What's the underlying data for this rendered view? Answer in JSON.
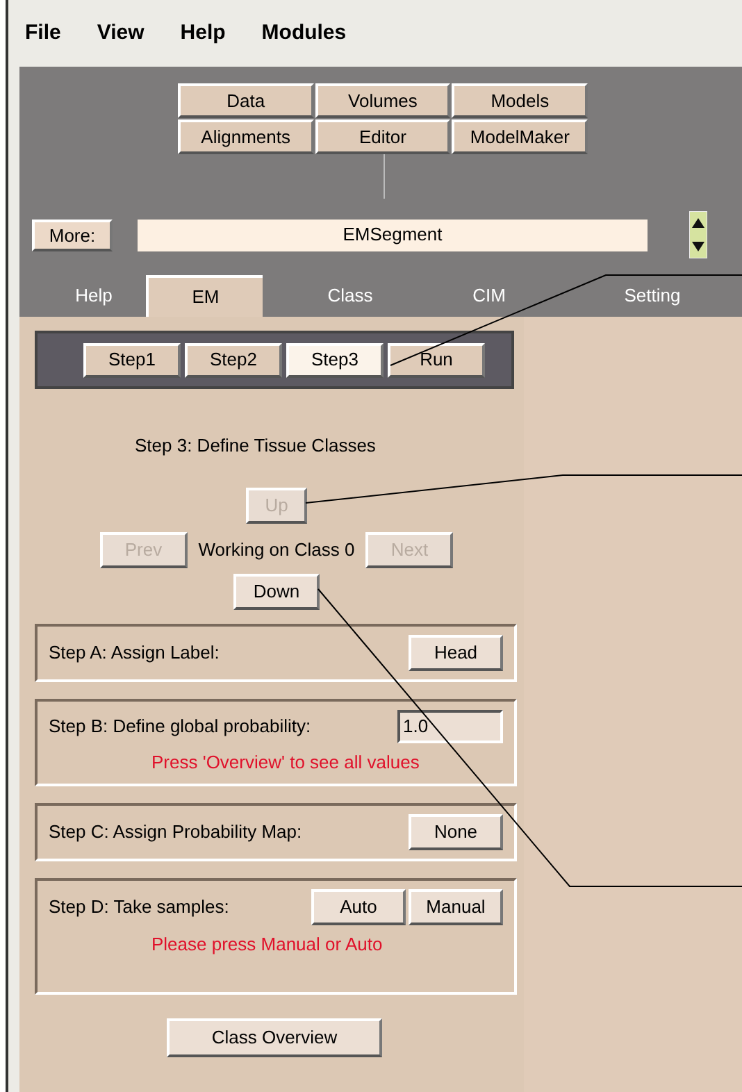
{
  "menu": [
    "File",
    "View",
    "Help",
    "Modules"
  ],
  "module_buttons": [
    "Data",
    "Volumes",
    "Models",
    "Alignments",
    "Editor",
    "ModelMaker"
  ],
  "more_button": "More:",
  "module_field": {
    "value": "EMSegment"
  },
  "tabs": [
    {
      "label": "Help",
      "selected": false
    },
    {
      "label": "EM",
      "selected": true
    },
    {
      "label": "Class",
      "selected": false
    },
    {
      "label": "CIM",
      "selected": false
    },
    {
      "label": "Setting",
      "selected": false
    }
  ],
  "step_buttons": [
    {
      "label": "Step1",
      "selected": false
    },
    {
      "label": "Step2",
      "selected": false
    },
    {
      "label": "Step3",
      "selected": true
    },
    {
      "label": "Run",
      "selected": false
    }
  ],
  "heading": "Step 3: Define Tissue Classes",
  "navigation": {
    "up": {
      "label": "Up",
      "disabled": true
    },
    "prev": {
      "label": "Prev",
      "disabled": true
    },
    "status": "Working on Class 0",
    "next": {
      "label": "Next",
      "disabled": true
    },
    "down": {
      "label": "Down",
      "disabled": false
    }
  },
  "steps": [
    {
      "kind": "button",
      "label": "Step A: Assign Label:",
      "buttons": [
        "Head"
      ]
    },
    {
      "kind": "input",
      "label": "Step B: Define global probability:",
      "value": "1.0",
      "note": "Press 'Overview' to see all values"
    },
    {
      "kind": "button",
      "label": "Step C:  Assign Probability Map:",
      "buttons": [
        "None"
      ]
    },
    {
      "kind": "button",
      "label": "Step D: Take samples:",
      "buttons": [
        "Auto",
        "Manual"
      ],
      "note": "Please press Manual or Auto"
    }
  ],
  "class_overview_button": "Class Overview"
}
